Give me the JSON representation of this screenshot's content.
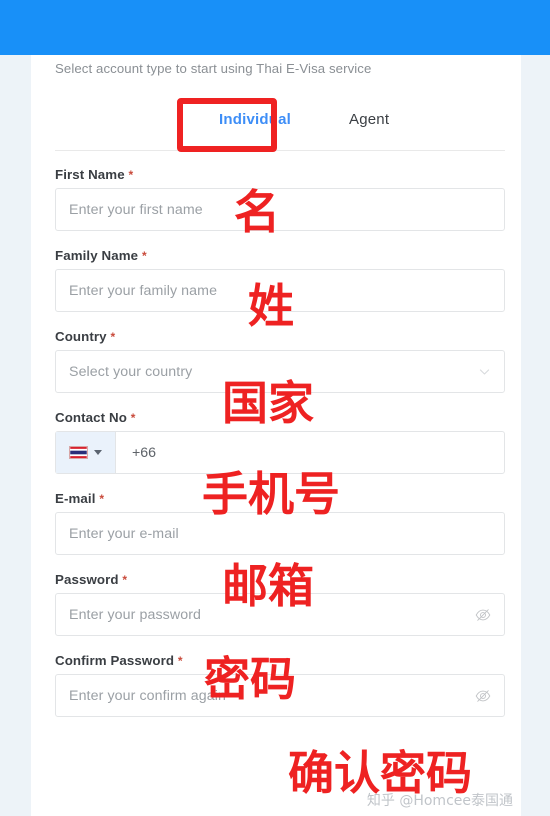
{
  "colors": {
    "header_blue": "#1890f8",
    "accent_blue": "#3e8ef7",
    "annotation_red": "#ee2222",
    "required_red": "#c94a3b",
    "page_background": "#edf3f8",
    "card_background": "#ffffff",
    "border_gray": "#e3e5e7",
    "placeholder_gray": "#9ba0a5"
  },
  "header": {
    "title": ""
  },
  "intro": {
    "text": "Select account type to start using Thai E-Visa service"
  },
  "tabs": [
    {
      "id": "individual",
      "label": "Individual",
      "selected": true
    },
    {
      "id": "agent",
      "label": "Agent",
      "selected": false
    }
  ],
  "form": {
    "required_marker": "*",
    "fields": [
      {
        "id": "first-name",
        "label": "First Name",
        "required": true,
        "placeholder": "Enter your first name",
        "value": "",
        "type": "text"
      },
      {
        "id": "family-name",
        "label": "Family Name",
        "required": true,
        "placeholder": "Enter your family name",
        "value": "",
        "type": "text"
      },
      {
        "id": "country",
        "label": "Country",
        "required": true,
        "placeholder": "Select your country",
        "value": "",
        "type": "select",
        "icon": "chevron-down-icon"
      },
      {
        "id": "contact-no",
        "label": "Contact No",
        "required": true,
        "placeholder": "",
        "value": "",
        "type": "phone",
        "dial_code": "+66",
        "flag": "thailand-flag-icon",
        "icon": "caret-down-icon"
      },
      {
        "id": "email",
        "label": "E-mail",
        "required": true,
        "placeholder": "Enter your e-mail",
        "value": "",
        "type": "email"
      },
      {
        "id": "password",
        "label": "Password",
        "required": true,
        "placeholder": "Enter your password",
        "value": "",
        "type": "password",
        "icon": "eye-slash-icon"
      },
      {
        "id": "confirm-password",
        "label": "Confirm Password",
        "required": true,
        "placeholder": "Enter your confirm again",
        "value": "",
        "type": "password",
        "icon": "eye-slash-icon"
      }
    ]
  },
  "annotations": {
    "tab_highlight_box": "Individual",
    "notes": [
      {
        "id": "first-name-note",
        "text": "名"
      },
      {
        "id": "family-name-note",
        "text": "姓"
      },
      {
        "id": "country-note",
        "text": "国家"
      },
      {
        "id": "contact-no-note",
        "text": "手机号"
      },
      {
        "id": "email-note",
        "text": "邮箱"
      },
      {
        "id": "password-note",
        "text": "密码"
      },
      {
        "id": "confirm-password-note",
        "text": "确认密码"
      }
    ]
  },
  "watermark": {
    "text": "知乎 @Homcee泰国通"
  }
}
